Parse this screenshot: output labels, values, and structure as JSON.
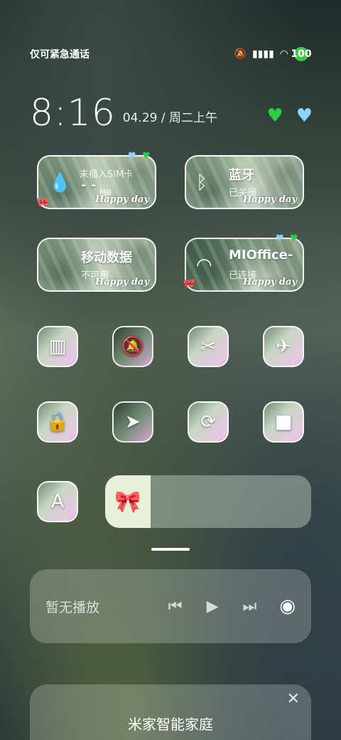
{
  "status_bar": {
    "carrier": "仅可紧急通话",
    "icons": [
      "mute-vibrate-icon",
      "signal-icon",
      "wifi-icon"
    ],
    "battery": "100"
  },
  "clock": {
    "time": "8:16",
    "date": "04.29 / 周二上午"
  },
  "tiles": {
    "sim": {
      "title": "-  -",
      "subtitle": "未插入SIM卡",
      "sub2": "MB",
      "happy": "Happy day"
    },
    "bluetooth": {
      "title": "蓝牙",
      "subtitle": "已关闭",
      "happy": "Happy day"
    },
    "mobile_data": {
      "title": "移动数据",
      "subtitle": "不可用",
      "happy": "Happy day"
    },
    "wifi": {
      "title": "MIOffice-",
      "subtitle": "已连接",
      "happy": "Happy day"
    }
  },
  "small_tiles": [
    {
      "name": "flashlight",
      "glyph": "▥"
    },
    {
      "name": "mute",
      "glyph": "🔕"
    },
    {
      "name": "screenshot",
      "glyph": "✂"
    },
    {
      "name": "airplane",
      "glyph": "✈"
    },
    {
      "name": "lock",
      "glyph": "🔒"
    },
    {
      "name": "location",
      "glyph": "➤"
    },
    {
      "name": "rotation-lock",
      "glyph": "⟳"
    },
    {
      "name": "video",
      "glyph": "■"
    }
  ],
  "font_tile_glyph": "A",
  "brightness": {
    "level": 0.22,
    "icon": "🎀"
  },
  "media": {
    "label": "暂无播放",
    "prev": "⏮",
    "play": "▶",
    "next": "⏭",
    "cast": "◉"
  },
  "home": {
    "title": "米家智能家庭",
    "close": "✕"
  },
  "colors": {
    "accent_green": "#2ecc40",
    "accent_blue": "#8fd4ff"
  }
}
